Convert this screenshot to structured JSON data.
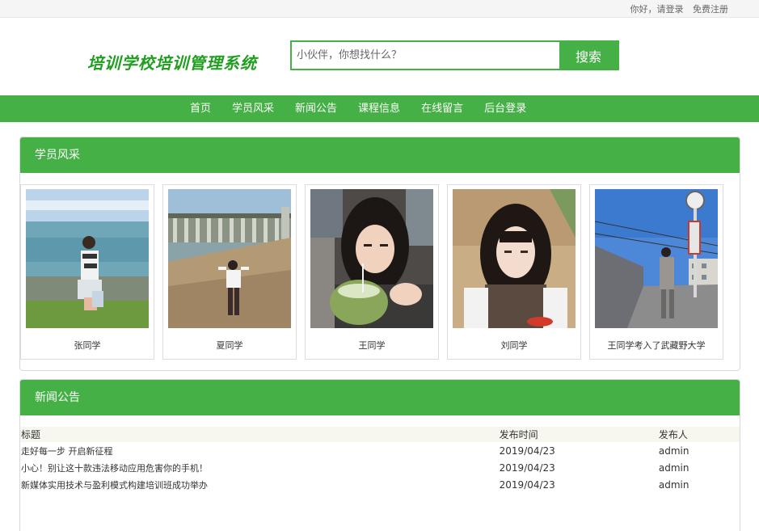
{
  "topbar": {
    "greeting": "你好，",
    "login": "请登录",
    "register": "免费注册"
  },
  "header": {
    "logo_text": "培训学校培训管理系统",
    "search_placeholder": "小伙伴，你想找什么？",
    "search_button": "搜索"
  },
  "nav": {
    "items": [
      "首页",
      "学员风采",
      "新闻公告",
      "课程信息",
      "在线留言",
      "后台登录"
    ]
  },
  "students": {
    "title": "学员风采",
    "items": [
      {
        "name": "张同学"
      },
      {
        "name": "夏同学"
      },
      {
        "name": "王同学"
      },
      {
        "name": "刘同学"
      },
      {
        "name": "王同学考入了武藏野大学"
      }
    ]
  },
  "news": {
    "title": "新闻公告",
    "columns": [
      "标题",
      "发布时间",
      "发布人"
    ],
    "rows": [
      {
        "title": "走好每一步 开启新征程",
        "date": "2019/04/23",
        "author": "admin"
      },
      {
        "title": "小心！别让这十款违法移动应用危害你的手机！",
        "date": "2019/04/23",
        "author": "admin"
      },
      {
        "title": "新媒体实用技术与盈利模式构建培训班成功举办",
        "date": "2019/04/23",
        "author": "admin"
      }
    ]
  },
  "colors": {
    "brand_green": "#45b045",
    "logo_green": "#1f9e1f"
  }
}
